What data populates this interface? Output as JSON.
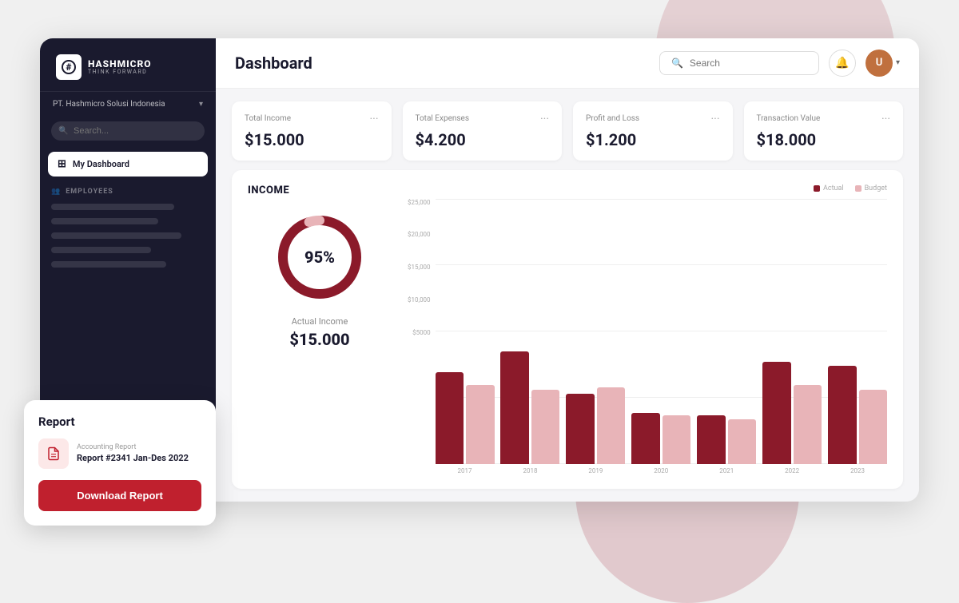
{
  "app": {
    "title": "Dashboard"
  },
  "sidebar": {
    "logo_name": "HASHMICRO",
    "logo_tagline": "THINK FORWARD",
    "logo_hash": "#",
    "company_name": "PT. Hashmicro Solusi Indonesia",
    "search_placeholder": "Search...",
    "nav_active_label": "My Dashboard",
    "section_employees_label": "EMPLOYEES"
  },
  "header": {
    "title": "Dashboard",
    "search_placeholder": "Search",
    "bell_icon": "🔔",
    "avatar_label": "U"
  },
  "stats": [
    {
      "label": "Total Income",
      "value": "$15.000"
    },
    {
      "label": "Total Expenses",
      "value": "$4.200"
    },
    {
      "label": "Profit and Loss",
      "value": "$1.200"
    },
    {
      "label": "Transaction Value",
      "value": "$18.000"
    }
  ],
  "income": {
    "section_label": "INCOME",
    "donut_percent": "95%",
    "actual_income_label": "Actual Income",
    "actual_income_value": "$15.000",
    "legend_actual": "Actual",
    "legend_budget": "Budget",
    "chart_colors": {
      "actual": "#8b1a2a",
      "budget": "#e8b4b8"
    },
    "y_labels": [
      "$25,000",
      "$20,000",
      "$15,000",
      "$10,000",
      "$5000"
    ],
    "x_labels": [
      "2017",
      "2018",
      "2019",
      "2020",
      "2021",
      "2022",
      "2023"
    ],
    "bars": [
      {
        "actual": 72,
        "budget": 62
      },
      {
        "actual": 88,
        "budget": 58
      },
      {
        "actual": 55,
        "budget": 60
      },
      {
        "actual": 40,
        "budget": 38
      },
      {
        "actual": 38,
        "budget": 35
      },
      {
        "actual": 80,
        "budget": 62
      },
      {
        "actual": 77,
        "budget": 58
      }
    ]
  },
  "report_popup": {
    "title": "Report",
    "report_type": "Accounting Report",
    "report_name": "Report #2341 Jan-Des 2022",
    "download_btn_label": "Download Report"
  }
}
